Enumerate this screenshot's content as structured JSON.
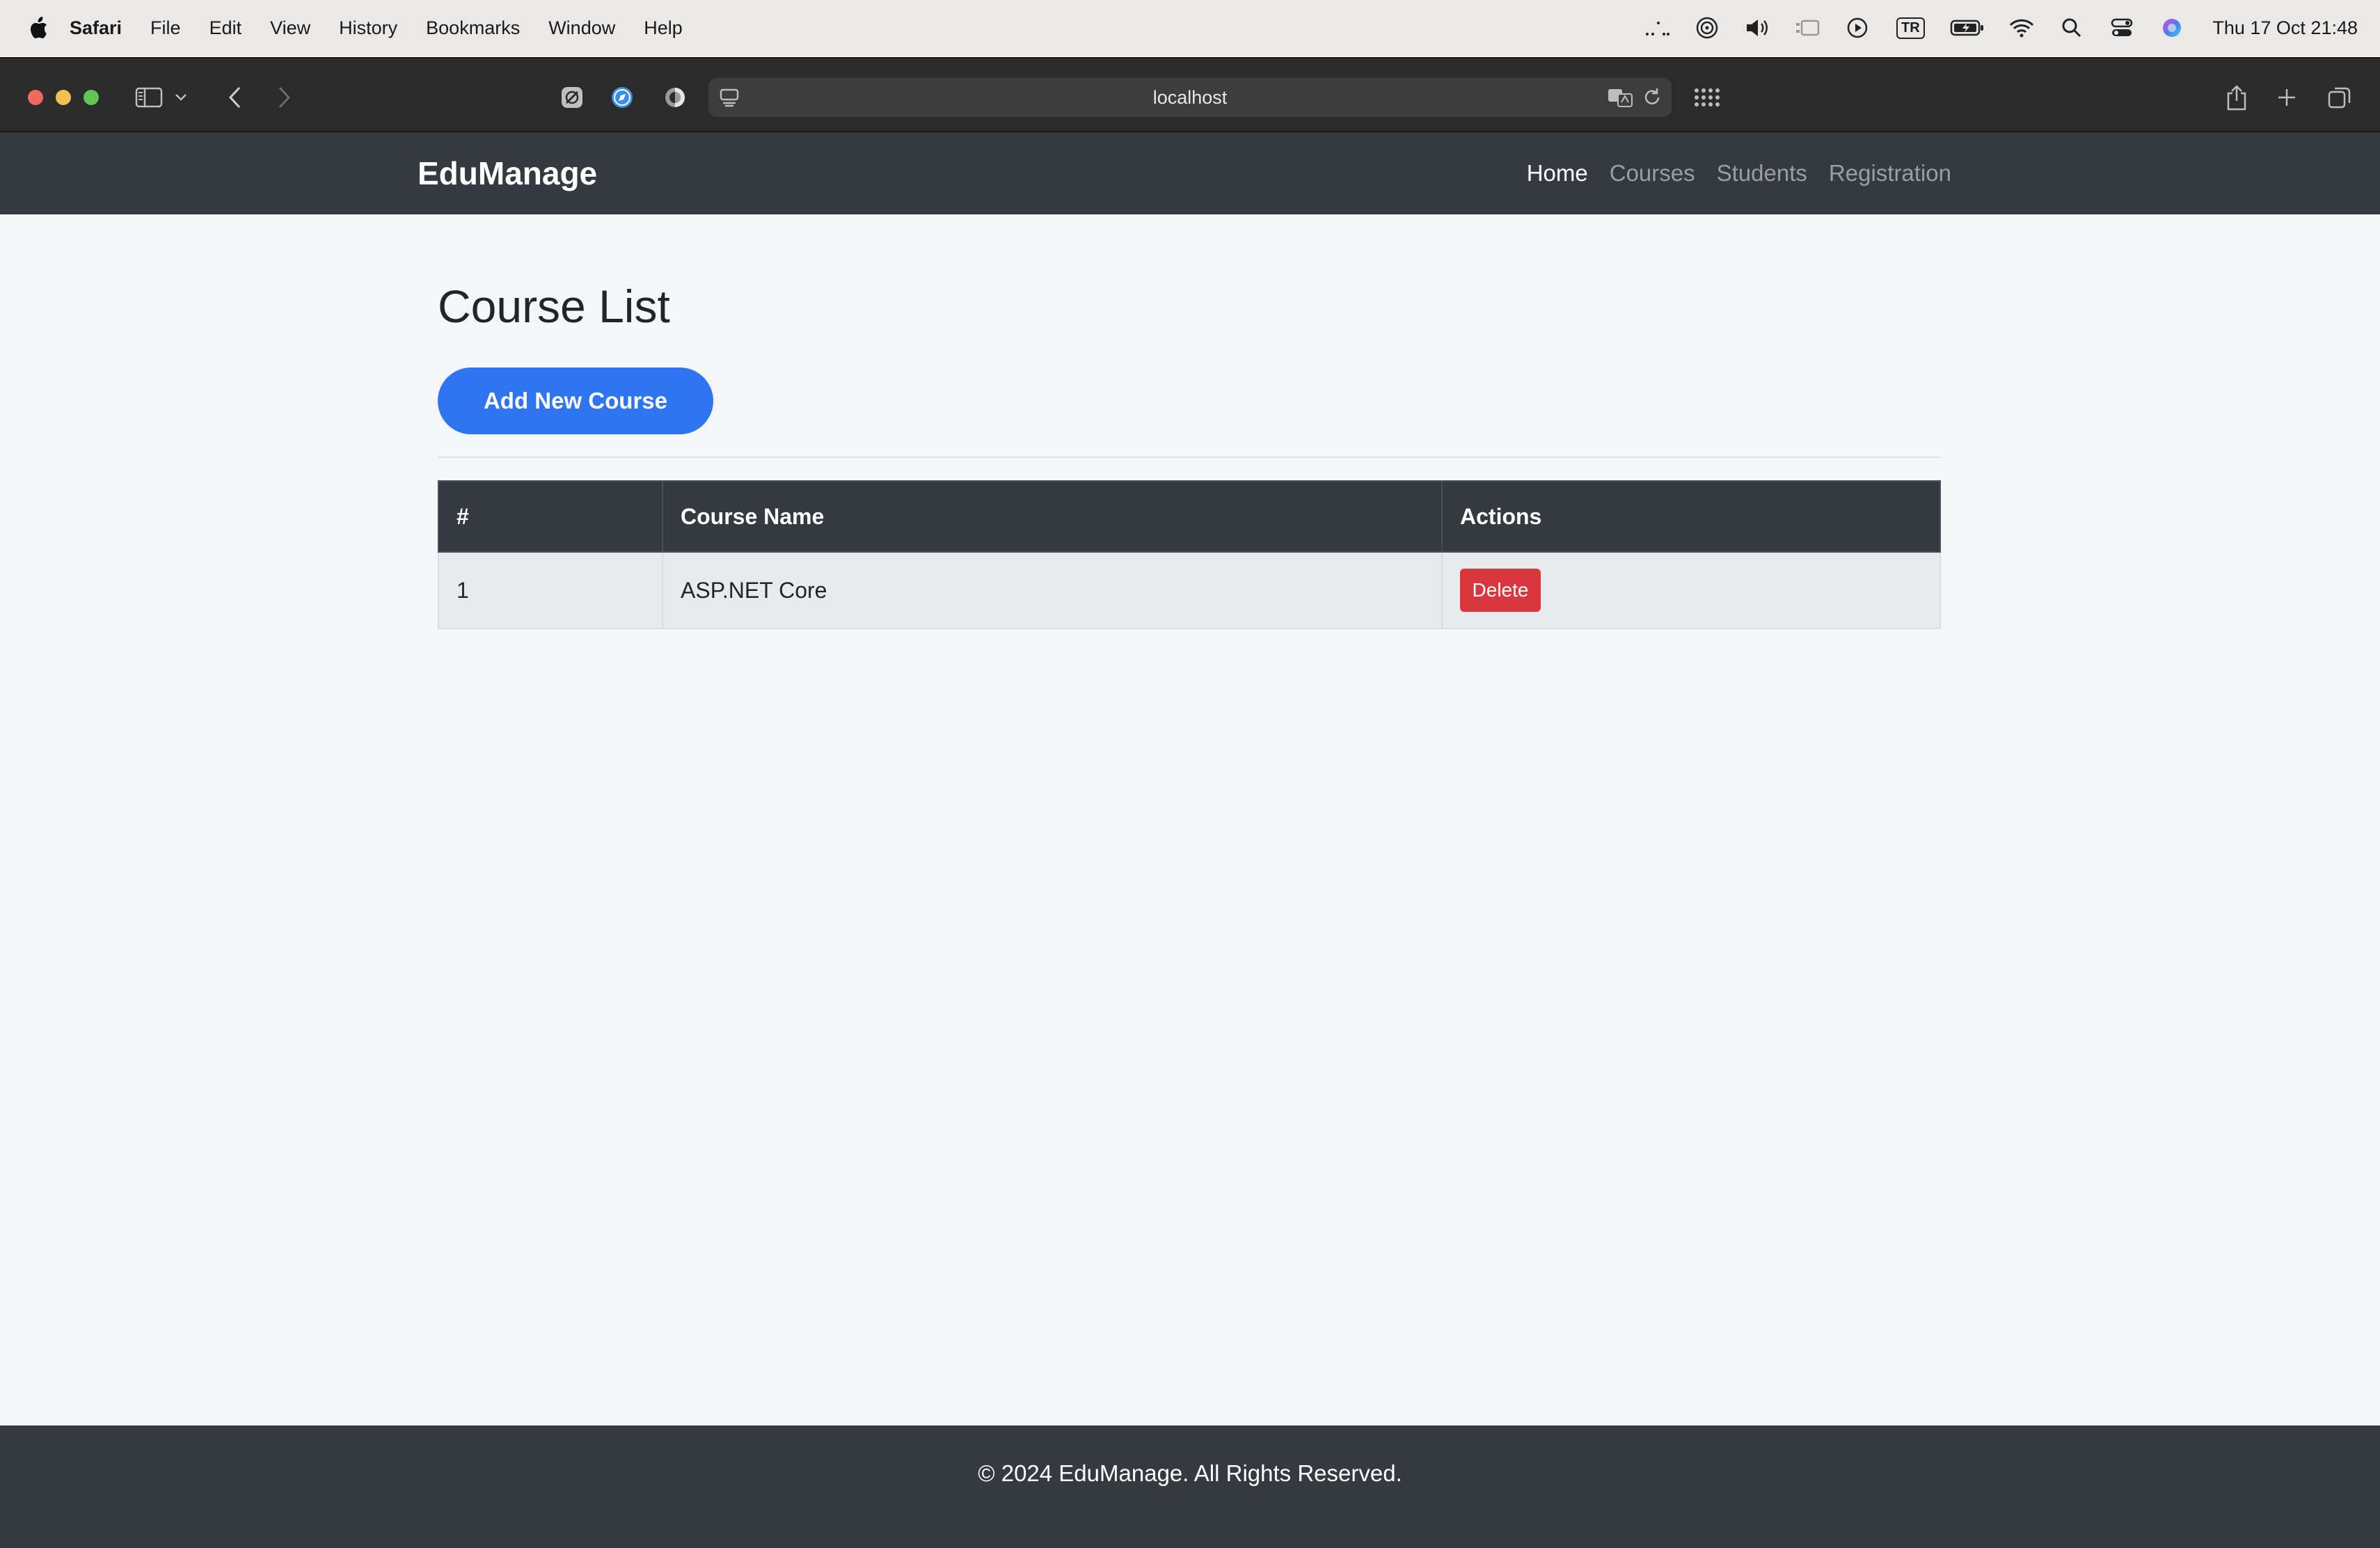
{
  "menubar": {
    "apple_icon": "apple-icon",
    "app_name": "Safari",
    "items": [
      "File",
      "Edit",
      "View",
      "History",
      "Bookmarks",
      "Window",
      "Help"
    ],
    "keyboard_layout": "TR",
    "clock": "Thu 17 Oct  21:48"
  },
  "browser": {
    "url": "localhost"
  },
  "site": {
    "brand": "EduManage",
    "nav": {
      "home": "Home",
      "courses": "Courses",
      "students": "Students",
      "registration": "Registration"
    }
  },
  "page": {
    "title": "Course List",
    "add_button": "Add New Course"
  },
  "table": {
    "headers": {
      "num": "#",
      "name": "Course Name",
      "actions": "Actions"
    },
    "rows": [
      {
        "num": "1",
        "name": "ASP.NET Core",
        "action": "Delete"
      }
    ]
  },
  "footer": {
    "text": "© 2024 EduManage. All Rights Reserved."
  },
  "colors": {
    "navbar": "#343a40",
    "primary": "#2f74f0",
    "danger": "#d9363e",
    "background": "#f5f6f8"
  }
}
